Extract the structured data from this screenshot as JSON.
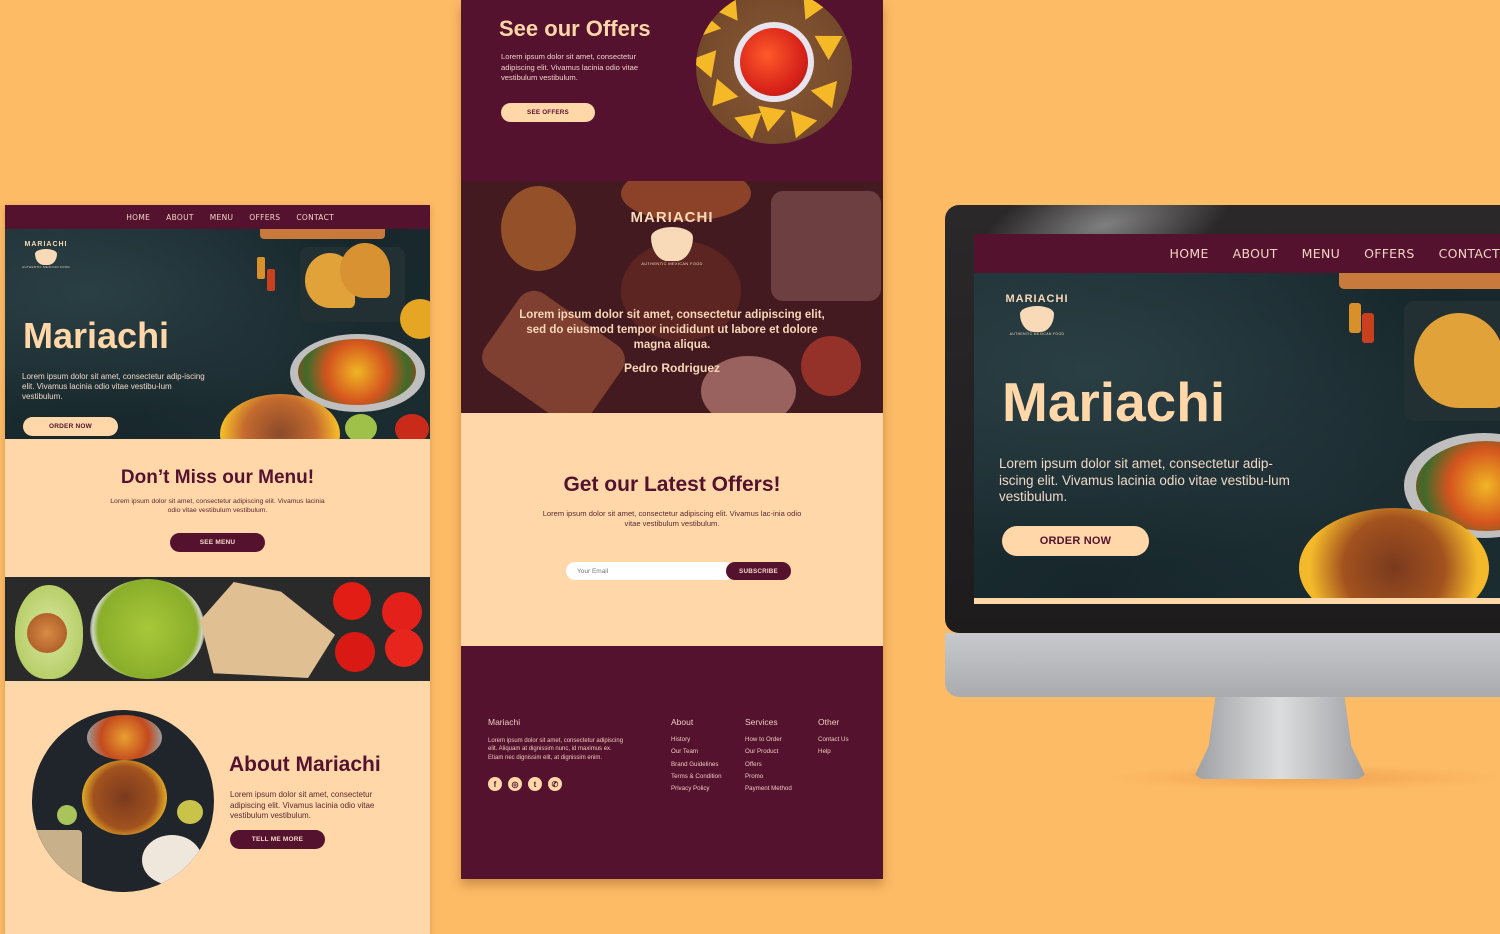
{
  "brand": {
    "name": "Mariachi",
    "logo_text": "MARIACHI",
    "logo_tagline": "AUTHENTIC MEXICAN FOOD"
  },
  "colors": {
    "background": "#fdbb66",
    "maroon": "#54122e",
    "cream": "#ffd7a8",
    "slate": "#1c2e32"
  },
  "nav": {
    "items": [
      {
        "label": "HOME"
      },
      {
        "label": "ABOUT"
      },
      {
        "label": "MENU"
      },
      {
        "label": "OFFERS"
      },
      {
        "label": "CONTACT"
      }
    ]
  },
  "hero": {
    "title": "Mariachi",
    "description": "Lorem ipsum dolor sit amet, consectetur adip-iscing elit. Vivamus lacinia odio vitae vestibu-lum vestibulum.",
    "button": "ORDER NOW"
  },
  "menu_section": {
    "title": "Don’t Miss our Menu!",
    "description": "Lorem ipsum dolor sit amet, consectetur adipiscing elit. Vivamus lacinia odio vitae vestibulum vestibulum.",
    "button": "SEE MENU"
  },
  "about_section": {
    "title": "About Mariachi",
    "description": "Lorem ipsum dolor sit amet, consectetur adipiscing elit. Vivamus lacinia odio vitae vestibulum vestibulum.",
    "button": "TELL ME MORE"
  },
  "offers_section": {
    "title": "See our Offers",
    "description": "Lorem ipsum dolor sit amet, consectetur adipiscing elit. Vivamus lacinia odio vitae vestibulum vestibulum.",
    "button": "SEE OFFERS"
  },
  "testimonial": {
    "quote": "Lorem ipsum dolor sit amet, consectetur adipiscing elit, sed do eiusmod tempor incididunt ut labore et dolore magna aliqua.",
    "author": "Pedro Rodriguez"
  },
  "newsletter": {
    "title": "Get our Latest Offers!",
    "description": "Lorem ipsum dolor sit amet, consectetur adipiscing elit. Vivamus lac-inia odio vitae vestibulum vestibulum.",
    "email_placeholder": "Your Email",
    "button": "SUBSCRIBE"
  },
  "footer": {
    "brand": "Mariachi",
    "description": "Lorem ipsum dolor sit amet, consectetur adipiscing elit. Aliquam at dignissim nunc, id maximus ex. Etiam nec dignissim elit, at dignissim enim.",
    "socials": [
      {
        "icon": "facebook-icon",
        "glyph": "f"
      },
      {
        "icon": "instagram-icon",
        "glyph": "◎"
      },
      {
        "icon": "twitter-icon",
        "glyph": "t"
      },
      {
        "icon": "whatsapp-icon",
        "glyph": "✆"
      }
    ],
    "columns": [
      {
        "title": "About",
        "links": [
          "History",
          "Our Team",
          "Brand Guidelines",
          "Terms & Condition",
          "Privacy Policy"
        ]
      },
      {
        "title": "Services",
        "links": [
          "How to Order",
          "Our Product",
          "Offers",
          "Promo",
          "Payment Method"
        ]
      },
      {
        "title": "Other",
        "links": [
          "Contact Us",
          "Help"
        ]
      }
    ]
  }
}
